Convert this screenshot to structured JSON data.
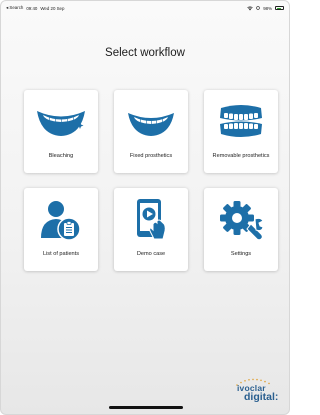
{
  "status_bar": {
    "back_label": "◂ Search",
    "time": "09:40",
    "date": "Wed 20 Sep",
    "battery": "98%"
  },
  "page_title": "Select workflow",
  "tiles": [
    {
      "label": "Bleaching",
      "icon": "bleaching-smile-icon"
    },
    {
      "label": "Fixed prosthetics",
      "icon": "fixed-prosthetics-icon"
    },
    {
      "label": "Removable prosthetics",
      "icon": "denture-icon"
    },
    {
      "label": "List of patients",
      "icon": "patient-list-icon"
    },
    {
      "label": "Demo case",
      "icon": "tablet-play-icon"
    },
    {
      "label": "Settings",
      "icon": "gear-wrench-icon"
    }
  ],
  "brand": {
    "line1": "ivoclar",
    "line2": "digital:"
  },
  "colors": {
    "accent": "#1d6fa8",
    "brand": "#2a5f8f",
    "background": "#f4f4f4"
  }
}
